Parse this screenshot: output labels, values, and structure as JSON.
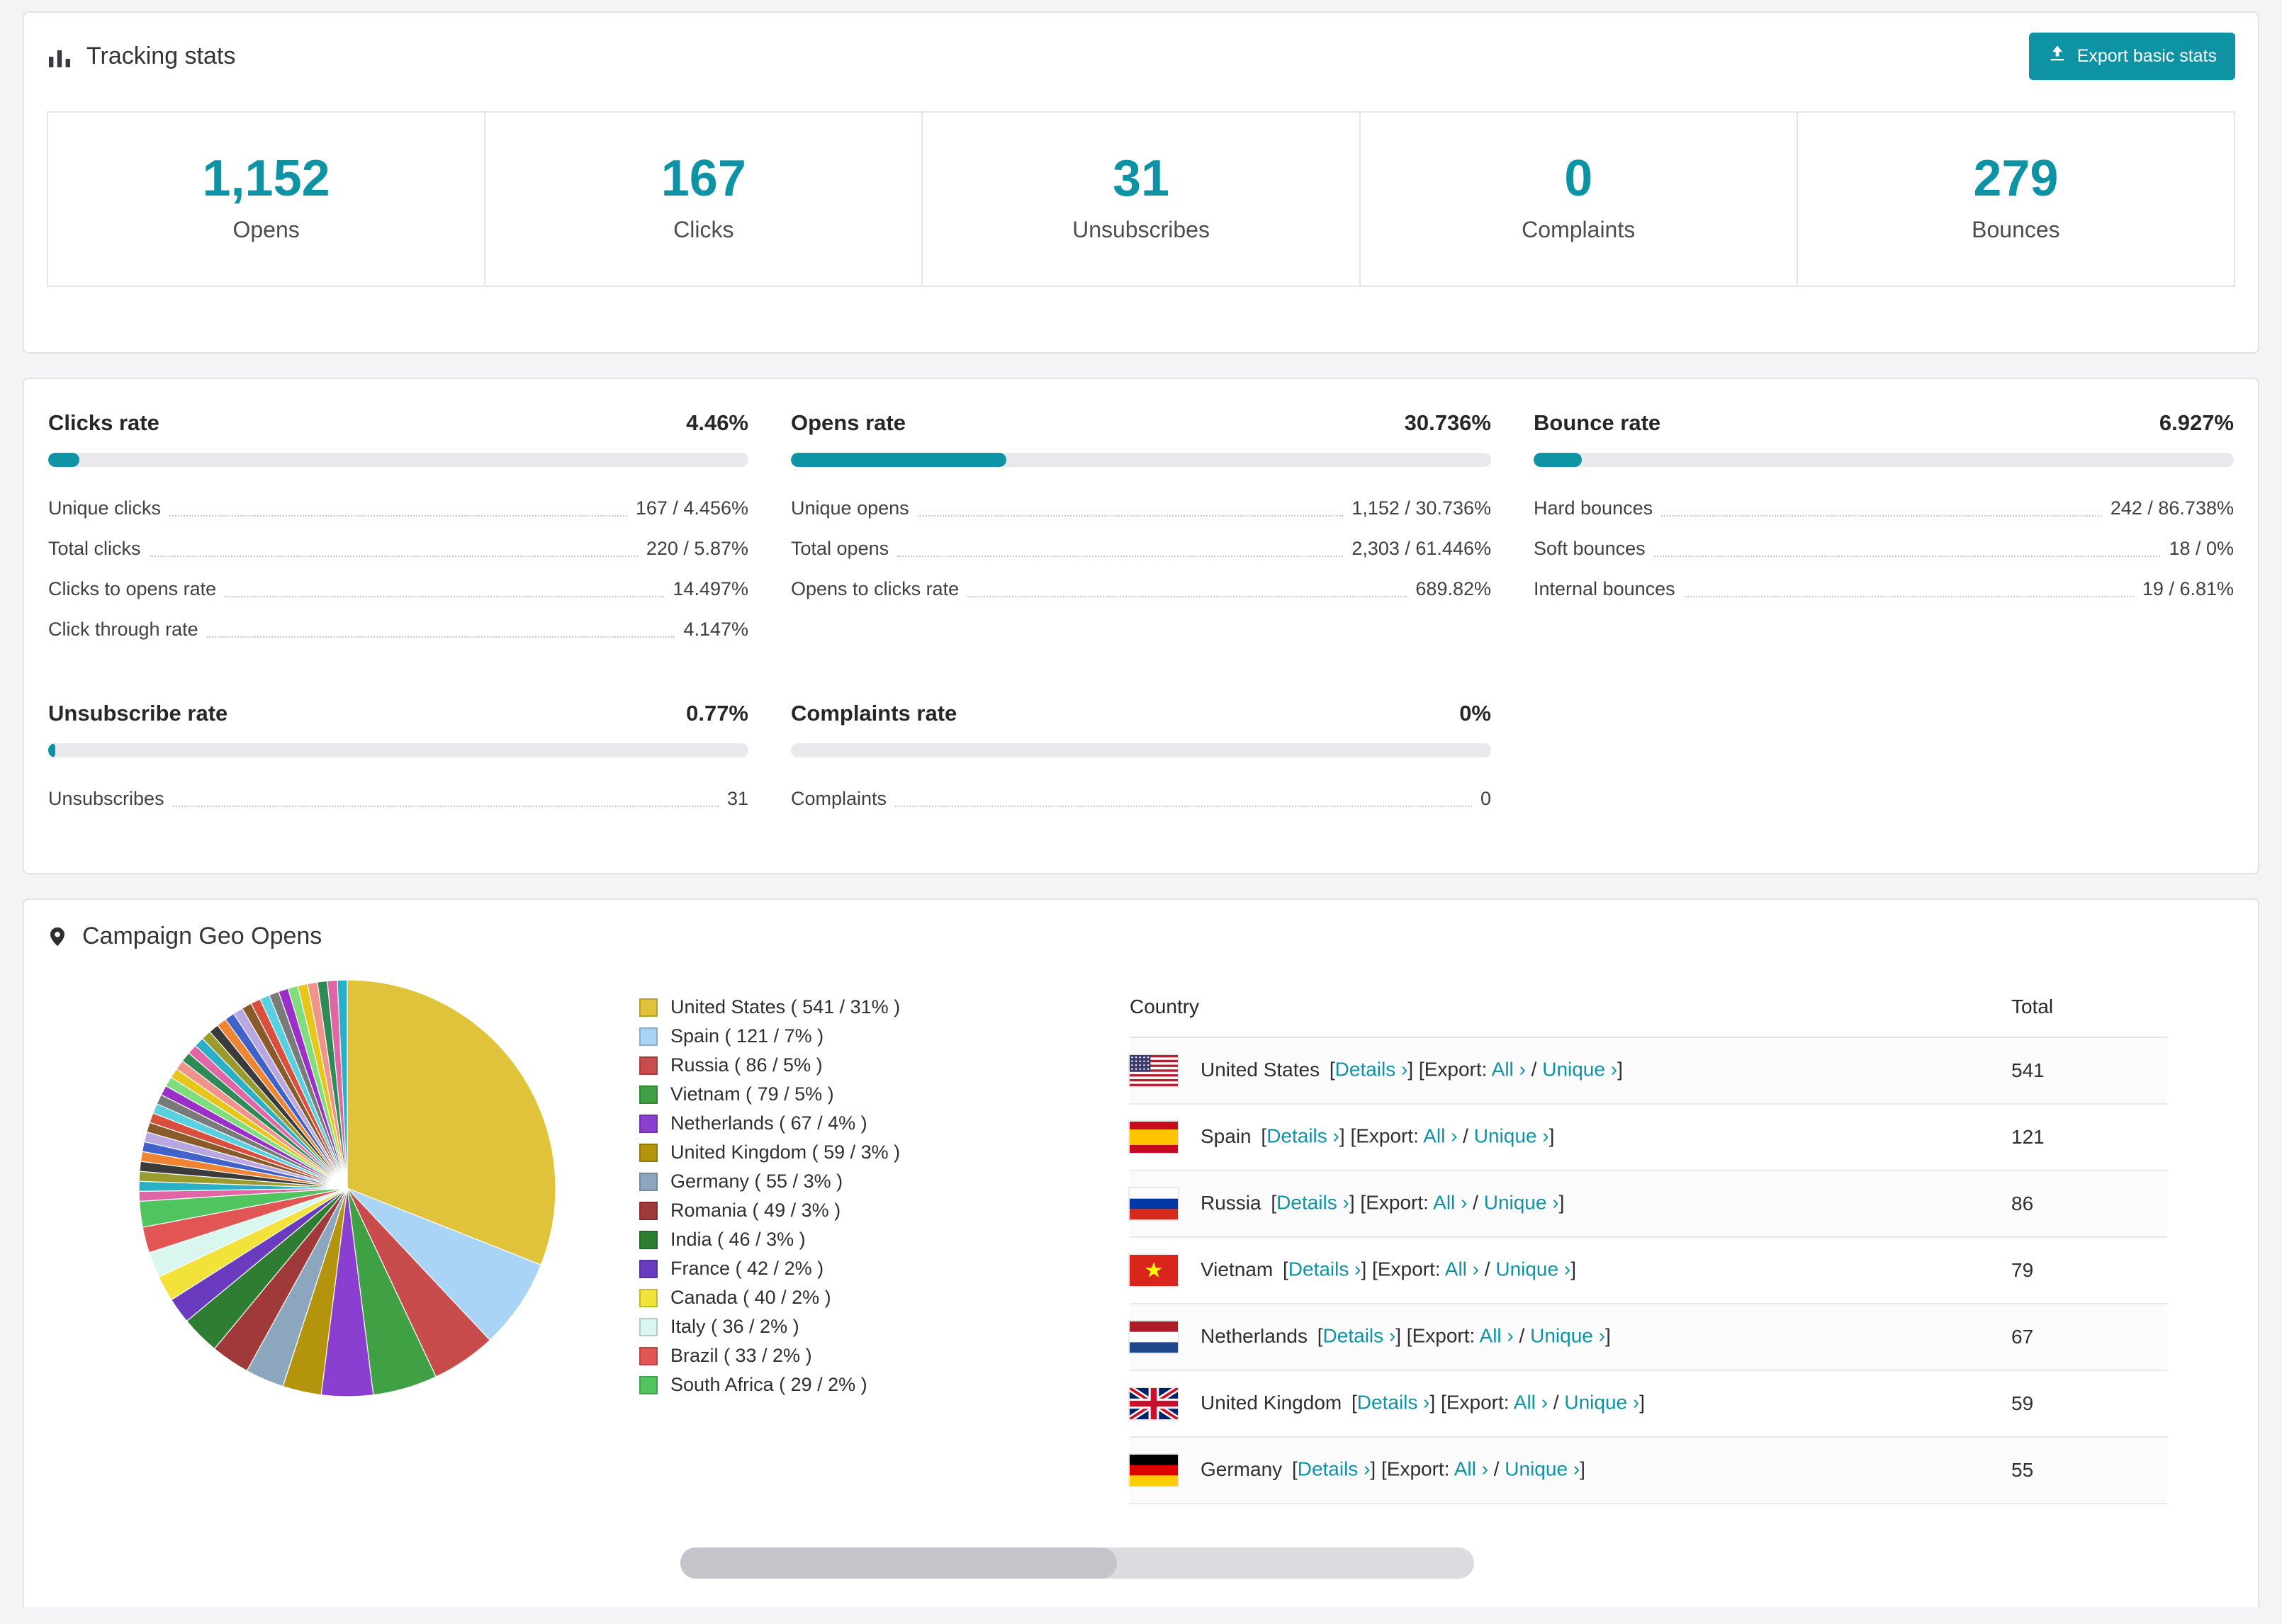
{
  "colors": {
    "accent": "#0e93a5",
    "page_bg": "#f4f4f6",
    "card_bg": "#ffffff",
    "card_border": "#e3e3e7",
    "text": "#2e2e33",
    "track": "#e9e9ed",
    "leader": "#c6c6ca",
    "row_border": "#e9e9ec"
  },
  "icons": {
    "tracking": "bar-chart-icon",
    "export": "export-icon",
    "geo": "map-pin-icon"
  },
  "tracking": {
    "title": "Tracking stats",
    "export_label": "Export basic stats",
    "stats": [
      {
        "value": "1,152",
        "label": "Opens"
      },
      {
        "value": "167",
        "label": "Clicks"
      },
      {
        "value": "31",
        "label": "Unsubscribes"
      },
      {
        "value": "0",
        "label": "Complaints"
      },
      {
        "value": "279",
        "label": "Bounces"
      }
    ]
  },
  "rates": [
    {
      "title": "Clicks rate",
      "value": "4.46%",
      "percent": 4.46,
      "rows": [
        {
          "label": "Unique clicks",
          "value": "167 / 4.456%"
        },
        {
          "label": "Total clicks",
          "value": "220 / 5.87%"
        },
        {
          "label": "Clicks to opens rate",
          "value": "14.497%"
        },
        {
          "label": "Click through rate",
          "value": "4.147%"
        }
      ]
    },
    {
      "title": "Opens rate",
      "value": "30.736%",
      "percent": 30.736,
      "rows": [
        {
          "label": "Unique opens",
          "value": "1,152 / 30.736%"
        },
        {
          "label": "Total opens",
          "value": "2,303 / 61.446%"
        },
        {
          "label": "Opens to clicks rate",
          "value": "689.82%"
        }
      ]
    },
    {
      "title": "Bounce rate",
      "value": "6.927%",
      "percent": 6.927,
      "rows": [
        {
          "label": "Hard bounces",
          "value": "242 / 86.738%"
        },
        {
          "label": "Soft bounces",
          "value": "18 / 0%"
        },
        {
          "label": "Internal bounces",
          "value": "19 / 6.81%"
        }
      ]
    },
    {
      "title": "Unsubscribe rate",
      "value": "0.77%",
      "percent": 0.77,
      "rows": [
        {
          "label": "Unsubscribes",
          "value": "31"
        }
      ]
    },
    {
      "title": "Complaints rate",
      "value": "0%",
      "percent": 0,
      "rows": [
        {
          "label": "Complaints",
          "value": "0"
        }
      ]
    }
  ],
  "geo": {
    "title": "Campaign Geo Opens",
    "table": {
      "country_header": "Country",
      "total_header": "Total",
      "labels": {
        "details": "Details",
        "export": "Export:",
        "all": "All",
        "unique": "Unique"
      },
      "rows": [
        {
          "country": "United States",
          "flag": "us",
          "total": "541"
        },
        {
          "country": "Spain",
          "flag": "es",
          "total": "121"
        },
        {
          "country": "Russia",
          "flag": "ru",
          "total": "86"
        },
        {
          "country": "Vietnam",
          "flag": "vn",
          "total": "79"
        },
        {
          "country": "Netherlands",
          "flag": "nl",
          "total": "67"
        },
        {
          "country": "United Kingdom",
          "flag": "gb",
          "total": "59"
        },
        {
          "country": "Germany",
          "flag": "de",
          "total": "55"
        }
      ]
    },
    "chart_data": {
      "type": "pie",
      "title": "Campaign Geo Opens",
      "legend_position": "right",
      "series": [
        {
          "name": "United States",
          "value": 541,
          "percent": 31,
          "color": "#e0c33b"
        },
        {
          "name": "Spain",
          "value": 121,
          "percent": 7,
          "color": "#aad4f5"
        },
        {
          "name": "Russia",
          "value": 86,
          "percent": 5,
          "color": "#c94c4c"
        },
        {
          "name": "Vietnam",
          "value": 79,
          "percent": 5,
          "color": "#3fa044"
        },
        {
          "name": "Netherlands",
          "value": 67,
          "percent": 4,
          "color": "#8a3fd1"
        },
        {
          "name": "United Kingdom",
          "value": 59,
          "percent": 3,
          "color": "#b5940d"
        },
        {
          "name": "Germany",
          "value": 55,
          "percent": 3,
          "color": "#8ba6bd"
        },
        {
          "name": "Romania",
          "value": 49,
          "percent": 3,
          "color": "#a03a3a"
        },
        {
          "name": "India",
          "value": 46,
          "percent": 3,
          "color": "#2e7d32"
        },
        {
          "name": "France",
          "value": 42,
          "percent": 2,
          "color": "#6a3bbf"
        },
        {
          "name": "Canada",
          "value": 40,
          "percent": 2,
          "color": "#f2e239"
        },
        {
          "name": "Italy",
          "value": 36,
          "percent": 2,
          "color": "#d9f6ef"
        },
        {
          "name": "Brazil",
          "value": 33,
          "percent": 2,
          "color": "#e25555"
        },
        {
          "name": "South Africa",
          "value": 29,
          "percent": 2,
          "color": "#4fc45f"
        }
      ],
      "others": {
        "percent_total": 26,
        "segment_count": 34,
        "palette": [
          "#e066a6",
          "#2ab0c5",
          "#9a9a2d",
          "#3b3b3b",
          "#ef8532",
          "#4062c9",
          "#b8a7e0",
          "#8a5a2b",
          "#d94f3d",
          "#58d0e0",
          "#7a7a7a",
          "#9b30c9",
          "#7ede7e",
          "#e6c619",
          "#f0938a",
          "#2e8b57"
        ]
      }
    }
  }
}
